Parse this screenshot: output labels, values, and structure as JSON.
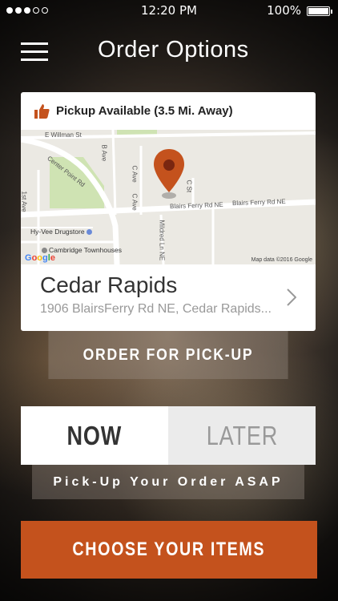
{
  "status_bar": {
    "time": "12:20 PM",
    "battery": "100%"
  },
  "header": {
    "title": "Order Options"
  },
  "store": {
    "pickup_label": "Pickup Available (3.5 Mi. Away)",
    "city": "Cedar Rapids",
    "address": "1906 BlairsFerry Rd NE, Cedar Rapids..."
  },
  "map": {
    "streets": {
      "willman": "E Willman St",
      "center_point": "Center Point Rd",
      "b_ave": "B Ave",
      "c_ave_1": "C Ave",
      "c_ave_2": "C Ave",
      "c_st": "C St",
      "first_ave": "1st Ave",
      "blairs_1": "Blairs Ferry Rd NE",
      "blairs_2": "Blairs Ferry Rd NE",
      "mildred": "Mildred Ln NE"
    },
    "places": {
      "hyvee": "Hy-Vee Drugstore",
      "cambridge": "Cambridge Townhouses"
    },
    "credit": "Map data ©2016 Google",
    "logo": [
      "G",
      "o",
      "o",
      "g",
      "l",
      "e"
    ],
    "pin_color": "#c4521d"
  },
  "actions": {
    "order_pickup": "ORDER FOR PICK-UP",
    "now": "NOW",
    "later": "LATER",
    "asap": "Pick-Up Your Order ASAP",
    "choose_items": "CHOOSE YOUR ITEMS"
  },
  "colors": {
    "accent": "#c4521d"
  }
}
